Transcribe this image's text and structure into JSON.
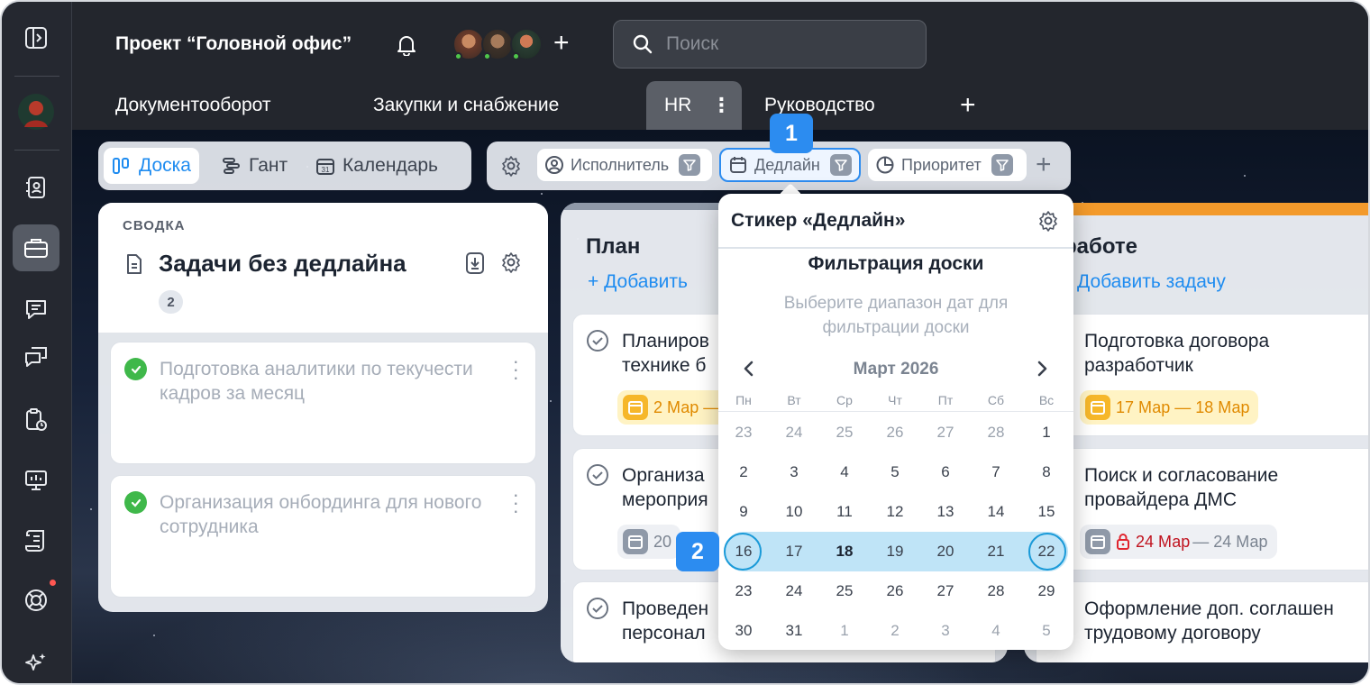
{
  "header": {
    "project_title": "Проект “Головной офис”",
    "add_member_label": "+",
    "search_placeholder": "Поиск"
  },
  "tabs": [
    {
      "label": "Документооборот"
    },
    {
      "label": "Закупки и снабжение"
    },
    {
      "label": "HR",
      "menu": "⋮"
    },
    {
      "label": "Руководство"
    },
    {
      "label": "+"
    }
  ],
  "views": [
    {
      "label": "Доска"
    },
    {
      "label": "Гант"
    },
    {
      "label": "Календарь"
    }
  ],
  "filters": [
    {
      "label": "Исполнитель"
    },
    {
      "label": "Дедлайн"
    },
    {
      "label": "Приоритет"
    }
  ],
  "add_filter_label": "+",
  "summary": {
    "label": "СВОДКА",
    "title": "Задачи без дедлайна",
    "count": "2",
    "items": [
      {
        "title": "Подготовка аналитики по текучести кадров за месяц"
      },
      {
        "title": "Организация онбординга для нового сотрудника"
      }
    ]
  },
  "columns": [
    {
      "title": "План",
      "add_label": "+ Добавить",
      "tasks": [
        {
          "title": "Планиров… технике б…",
          "line1": "Планиров",
          "line2": "технике б",
          "date": "2 Мар —"
        },
        {
          "title": "Организа… мероприя…",
          "line1": "Организа",
          "line2": "мероприя",
          "date": "20"
        },
        {
          "title": "Проведен… персонал…",
          "line1": "Проведен",
          "line2": "персонал"
        }
      ]
    },
    {
      "title": "работе",
      "add_label": "Добавить задачу",
      "accent": "#f39a2b",
      "tasks": [
        {
          "line1": "Подготовка договора",
          "line2": "разработчик",
          "date": "17 Мар — 18 Мар"
        },
        {
          "line1": "Поиск и согласование",
          "line2": "провайдера ДМС",
          "date_start": "24 Мар",
          "date_end": "— 24 Мар"
        },
        {
          "line1": "Оформление доп. соглашен",
          "line2": "трудовому договору"
        }
      ]
    }
  ],
  "popover": {
    "title": "Стикер «Дедлайн»",
    "subtitle": "Фильтрация доски",
    "hint": "Выберите диапазон дат для фильтрации доски",
    "month": "Март 2026",
    "weekdays": [
      "Пн",
      "Вт",
      "Ср",
      "Чт",
      "Пт",
      "Сб",
      "Вс"
    ],
    "weeks": [
      [
        "23",
        "24",
        "25",
        "26",
        "27",
        "28",
        "1"
      ],
      [
        "2",
        "3",
        "4",
        "5",
        "6",
        "7",
        "8"
      ],
      [
        "9",
        "10",
        "11",
        "12",
        "13",
        "14",
        "15"
      ],
      [
        "16",
        "17",
        "18",
        "19",
        "20",
        "21",
        "22"
      ],
      [
        "23",
        "24",
        "25",
        "26",
        "27",
        "28",
        "29"
      ],
      [
        "30",
        "31",
        "1",
        "2",
        "3",
        "4",
        "5"
      ]
    ],
    "range_start": "16",
    "range_end": "22",
    "today": "18"
  },
  "steps": [
    "1",
    "2"
  ],
  "colors": {
    "accent": "#1f8cf0",
    "range": "#bfe4f7",
    "step": "#2c8cf0",
    "in_progress": "#f39a2b",
    "done": "#3fb84a",
    "overdue": "#e0242e"
  }
}
